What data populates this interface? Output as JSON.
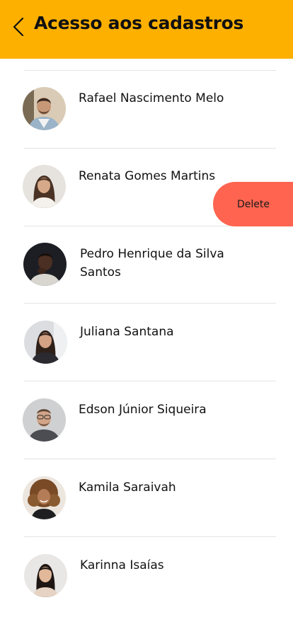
{
  "header": {
    "title": "Acesso aos cadastros",
    "background_color": "#FDB000",
    "back_icon": "chevron-left-icon"
  },
  "contacts": [
    {
      "name": "Rafael Nascimento Melo"
    },
    {
      "name": "Renata Gomes Martins"
    },
    {
      "name": "Pedro Henrique da Silva Santos"
    },
    {
      "name": "Juliana Santana"
    },
    {
      "name": "Edson Júnior Siqueira"
    },
    {
      "name": "Kamila Saraivah"
    },
    {
      "name": "Karinna Isaías"
    }
  ],
  "swipe_action": {
    "label": "Delete",
    "color": "#FF6450",
    "contact_index": 1
  }
}
